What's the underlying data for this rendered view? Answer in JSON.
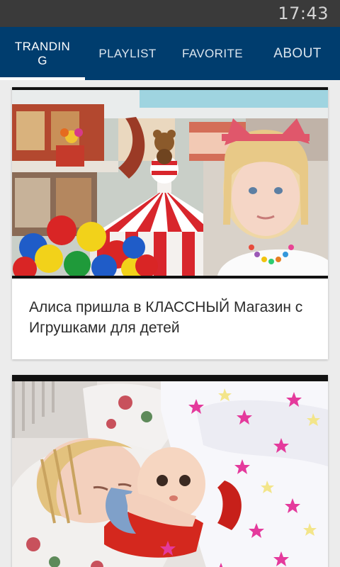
{
  "status_bar": {
    "time": "17:43"
  },
  "tabs": [
    {
      "label": "TRANDIN G",
      "active": true
    },
    {
      "label": "PLAYLIST",
      "active": false
    },
    {
      "label": "FAVORITE",
      "active": false
    },
    {
      "label": "ABOUT",
      "active": false
    }
  ],
  "colors": {
    "app_bar": "#003d6e",
    "status_bar": "#3a3a3a",
    "indicator": "#ffffff"
  },
  "videos": [
    {
      "title": "Алиса пришла в КЛАССНЫЙ Магазин с Игрушками для детей"
    },
    {
      "title": ""
    }
  ]
}
